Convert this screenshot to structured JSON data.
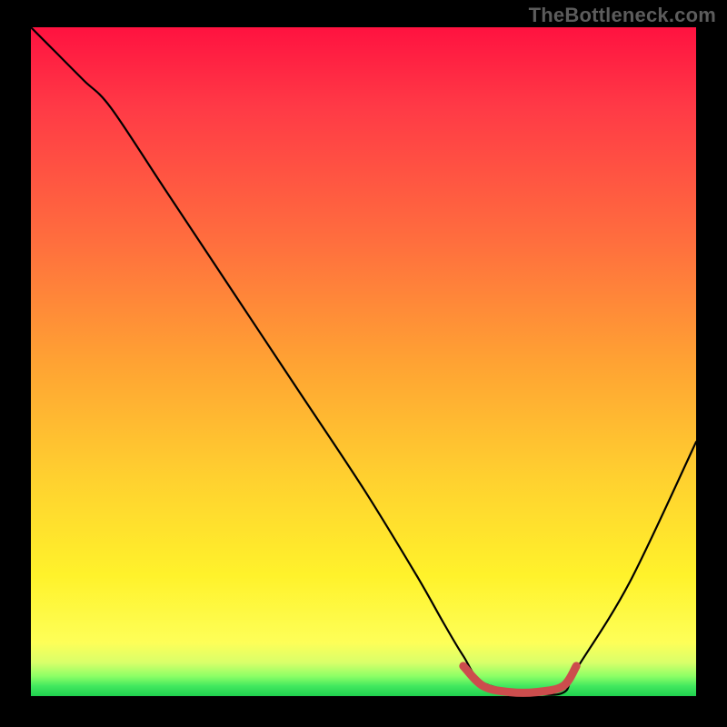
{
  "watermark": "TheBottleneck.com",
  "chart_data": {
    "type": "line",
    "title": "",
    "xlabel": "",
    "ylabel": "",
    "x_range": [
      0,
      100
    ],
    "y_range": [
      0,
      100
    ],
    "grid": false,
    "legend": false,
    "series": [
      {
        "name": "bottleneck-curve",
        "color": "#000000",
        "x": [
          0,
          4,
          8,
          12,
          20,
          30,
          40,
          50,
          58,
          62,
          65,
          68,
          75,
          80,
          82,
          90,
          100
        ],
        "y": [
          100,
          96,
          92,
          88,
          76,
          61,
          46,
          31,
          18,
          11,
          6,
          2,
          0.5,
          0.5,
          4,
          17,
          38
        ]
      },
      {
        "name": "optimal-flat-segment",
        "color": "#cc4d4d",
        "x": [
          65,
          68,
          72,
          76,
          80,
          82
        ],
        "y": [
          4.5,
          1.5,
          0.6,
          0.6,
          1.5,
          4.5
        ]
      }
    ],
    "background_gradient": {
      "stops": [
        {
          "pos": 0,
          "color": "#ff1240"
        },
        {
          "pos": 0.12,
          "color": "#ff3a46"
        },
        {
          "pos": 0.32,
          "color": "#ff6e3e"
        },
        {
          "pos": 0.5,
          "color": "#ffa233"
        },
        {
          "pos": 0.68,
          "color": "#ffd22f"
        },
        {
          "pos": 0.82,
          "color": "#fff22b"
        },
        {
          "pos": 0.92,
          "color": "#feff58"
        },
        {
          "pos": 0.95,
          "color": "#d9ff6a"
        },
        {
          "pos": 0.97,
          "color": "#8eff66"
        },
        {
          "pos": 0.985,
          "color": "#42e85f"
        },
        {
          "pos": 1.0,
          "color": "#1fd04e"
        }
      ]
    }
  }
}
